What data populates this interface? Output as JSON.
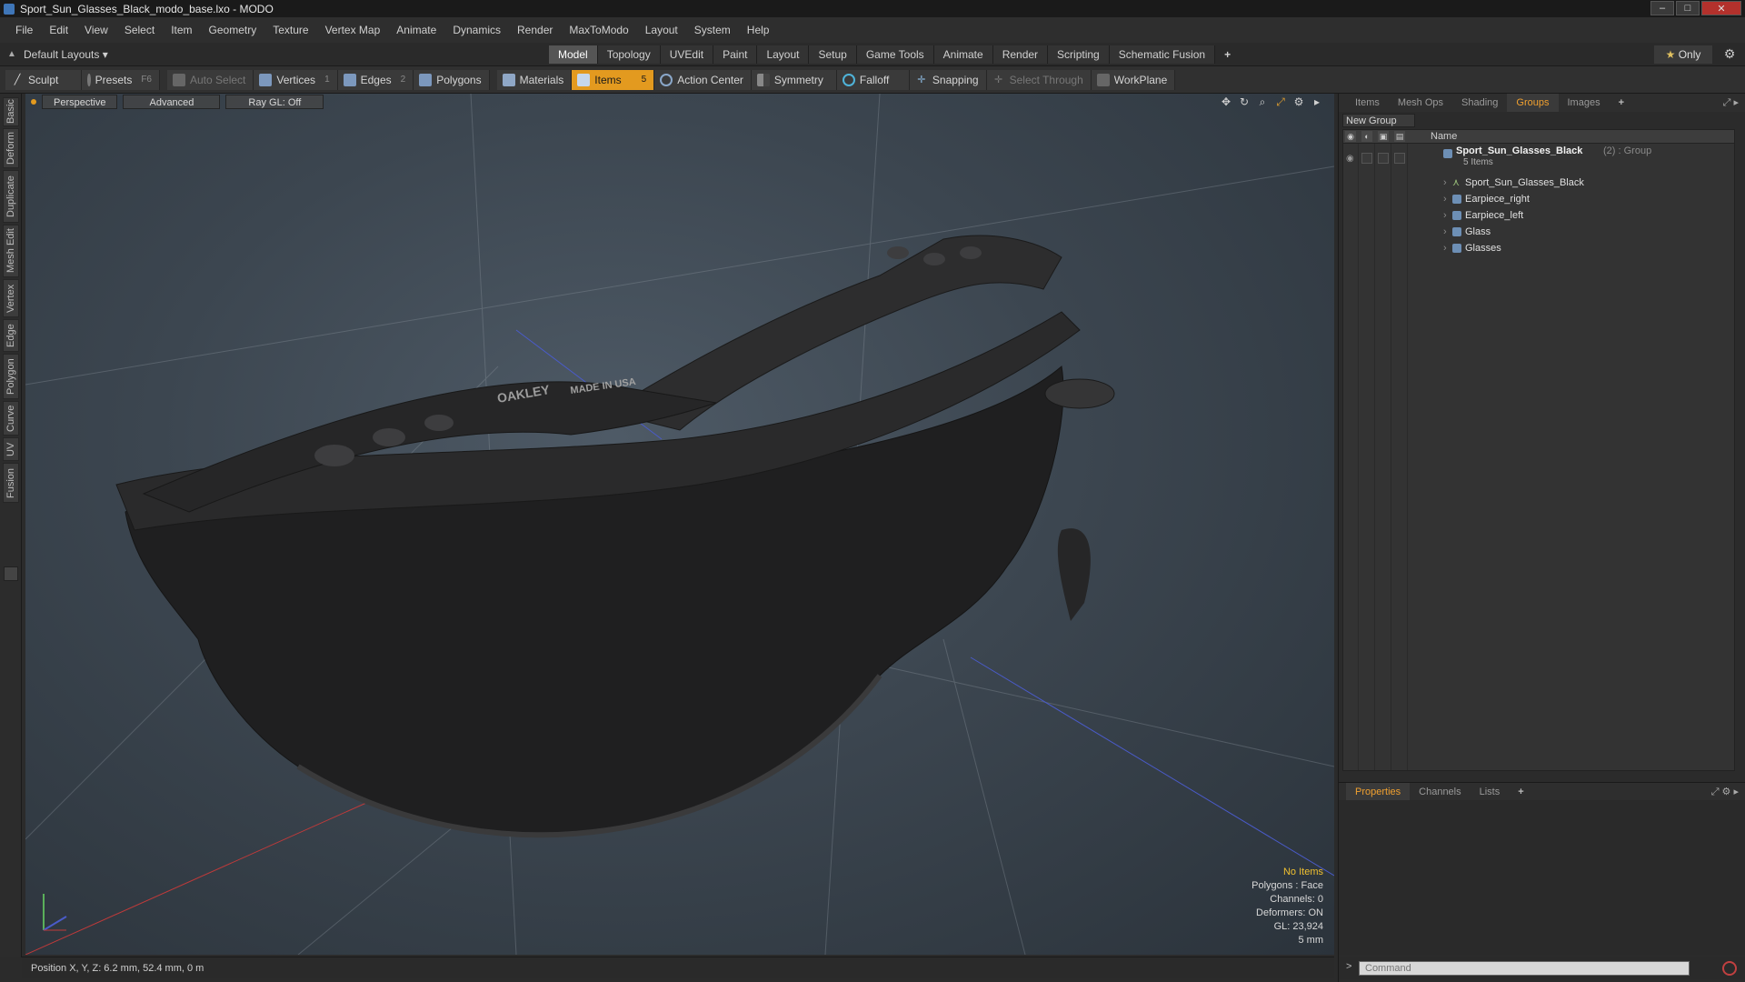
{
  "window": {
    "title": "Sport_Sun_Glasses_Black_modo_base.lxo - MODO",
    "minimize": "–",
    "maximize": "□",
    "close": "✕"
  },
  "menu": [
    "File",
    "Edit",
    "View",
    "Select",
    "Item",
    "Geometry",
    "Texture",
    "Vertex Map",
    "Animate",
    "Dynamics",
    "Render",
    "MaxToModo",
    "Layout",
    "System",
    "Help"
  ],
  "layout_bar": {
    "layout_select": "Default Layouts ▾",
    "tabs": [
      "Model",
      "Topology",
      "UVEdit",
      "Paint",
      "Layout",
      "Setup",
      "Game Tools",
      "Animate",
      "Render",
      "Scripting",
      "Schematic Fusion"
    ],
    "active_tab": "Model",
    "plus": "+",
    "only_star": "★",
    "only_label": "Only"
  },
  "toolbar": {
    "sculpt": "Sculpt",
    "presets": "Presets",
    "presets_key": "F6",
    "auto_select": "Auto Select",
    "vertices": "Vertices",
    "vertices_count": "1",
    "edges": "Edges",
    "edges_count": "2",
    "polygons": "Polygons",
    "materials": "Materials",
    "items": "Items",
    "items_count": "5",
    "action_center": "Action Center",
    "symmetry": "Symmetry",
    "falloff": "Falloff",
    "snapping": "Snapping",
    "select_through": "Select Through",
    "workplane": "WorkPlane"
  },
  "left_tabs": [
    "Basic",
    "Deform",
    "Duplicate",
    "Mesh Edit",
    "Vertex",
    "Edge",
    "Polygon",
    "Curve",
    "UV",
    "Fusion"
  ],
  "viewport": {
    "view_mode": "Perspective",
    "shading": "Advanced",
    "raygl": "Ray GL: Off",
    "stats": {
      "no_items": "No Items",
      "polygons": "Polygons : Face",
      "channels": "Channels: 0",
      "deformers": "Deformers: ON",
      "gl": "GL: 23,924",
      "scale": "5 mm"
    },
    "brand_text": "MADE IN USA",
    "logo_text": "OAKLEY"
  },
  "statusbar": {
    "position": "Position X, Y, Z:  6.2 mm, 52.4 mm, 0 m"
  },
  "right_panel": {
    "tabs": [
      "Items",
      "Mesh Ops",
      "Shading",
      "Groups",
      "Images"
    ],
    "active_tab": "Groups",
    "plus": "+",
    "new_group": "New Group",
    "name_col": "Name",
    "group": {
      "name": "Sport_Sun_Glasses_Black",
      "suffix": "(2) : Group",
      "count_label": "5 Items",
      "children": [
        "Sport_Sun_Glasses_Black",
        "Earpiece_right",
        "Earpiece_left",
        "Glass",
        "Glasses"
      ]
    },
    "props_tabs": [
      "Properties",
      "Channels",
      "Lists"
    ],
    "props_active": "Properties",
    "command_placeholder": "Command"
  },
  "colors": {
    "accent": "#e39a1f",
    "viewport_bg": "#3c4650",
    "panel_bg": "#2b2b2b"
  }
}
